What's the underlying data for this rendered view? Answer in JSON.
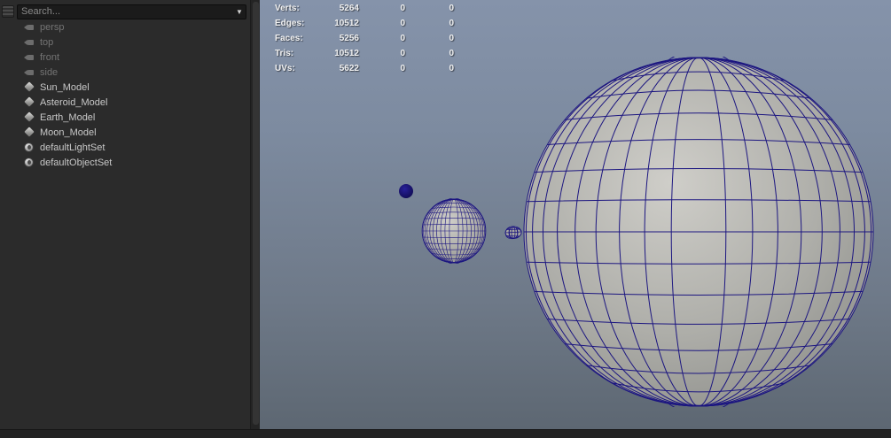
{
  "outliner": {
    "search_placeholder": "Search...",
    "items": [
      {
        "label": "persp",
        "icon": "camera"
      },
      {
        "label": "top",
        "icon": "camera"
      },
      {
        "label": "front",
        "icon": "camera"
      },
      {
        "label": "side",
        "icon": "camera"
      },
      {
        "label": "Sun_Model",
        "icon": "mesh"
      },
      {
        "label": "Asteroid_Model",
        "icon": "mesh"
      },
      {
        "label": "Earth_Model",
        "icon": "mesh"
      },
      {
        "label": "Moon_Model",
        "icon": "mesh"
      },
      {
        "label": "defaultLightSet",
        "icon": "set"
      },
      {
        "label": "defaultObjectSet",
        "icon": "set"
      }
    ]
  },
  "hud": {
    "rows": [
      {
        "label": "Verts:",
        "total": "5264",
        "col2": "0",
        "col3": "0"
      },
      {
        "label": "Edges:",
        "total": "10512",
        "col2": "0",
        "col3": "0"
      },
      {
        "label": "Faces:",
        "total": "5256",
        "col2": "0",
        "col3": "0"
      },
      {
        "label": "Tris:",
        "total": "10512",
        "col2": "0",
        "col3": "0"
      },
      {
        "label": "UVs:",
        "total": "5622",
        "col2": "0",
        "col3": "0"
      }
    ]
  },
  "viewport": {
    "objects": [
      "Sun_Model",
      "Earth_Model",
      "Moon_Model",
      "Asteroid_Model"
    ]
  },
  "colors": {
    "wireframe": "#1c1680",
    "moon_fill": "#1a1473",
    "panel_bg": "#2b2b2b",
    "viewport_top": "#8593aa",
    "viewport_bottom": "#5d6772"
  }
}
